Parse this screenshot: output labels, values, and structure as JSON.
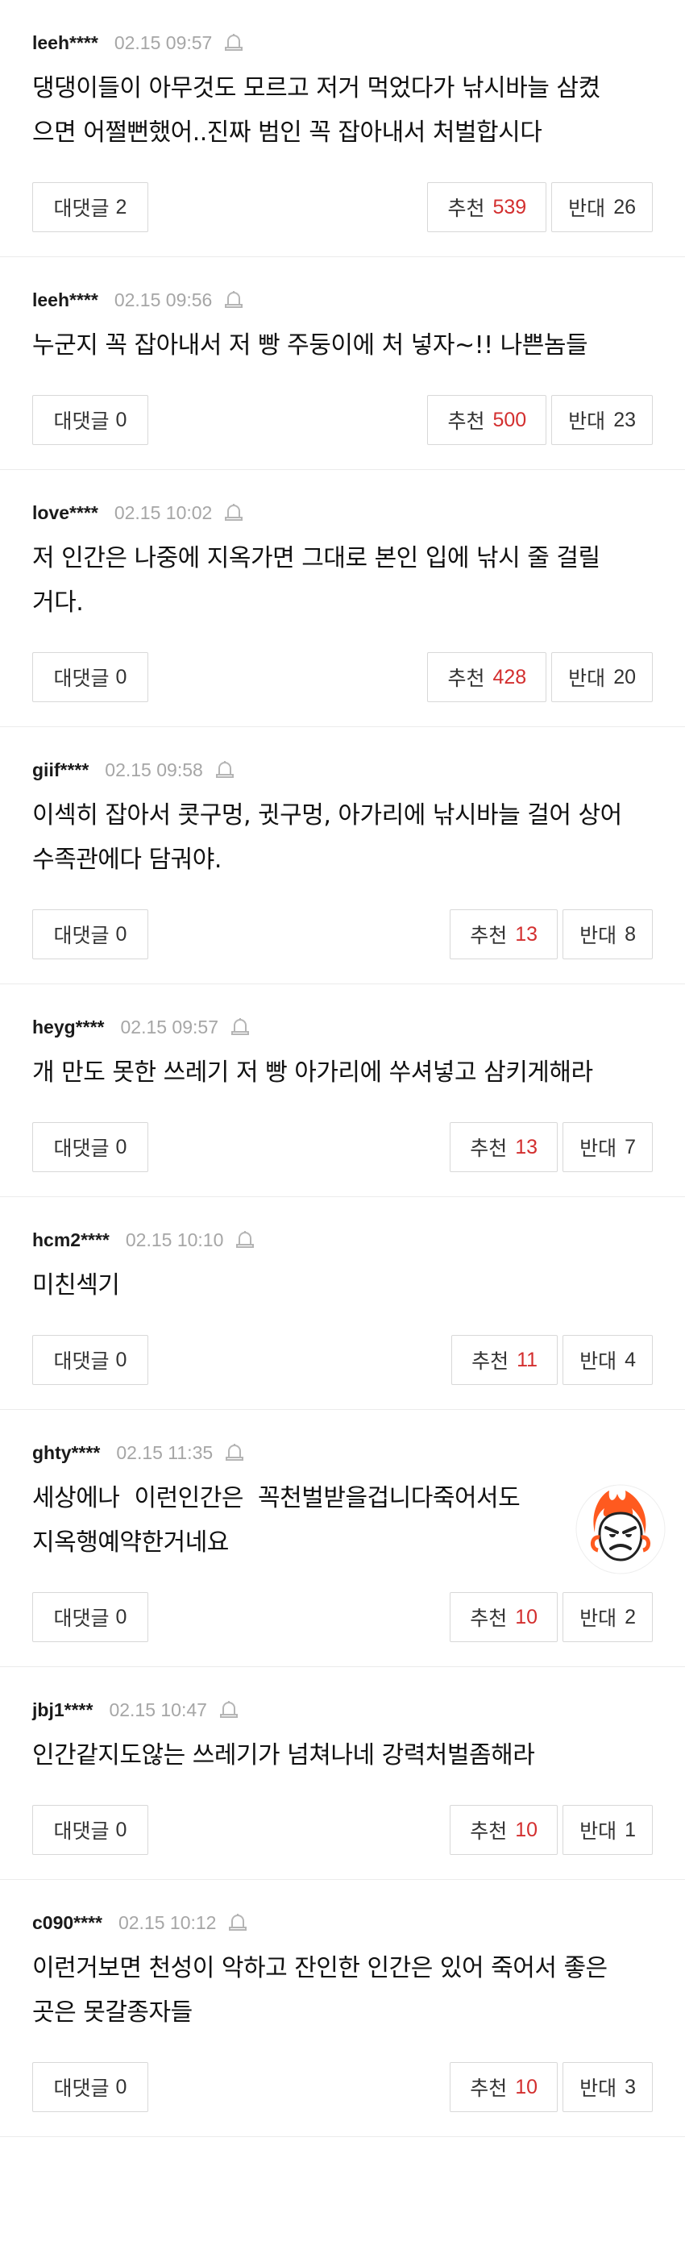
{
  "labels": {
    "reply": "대댓글",
    "recommend": "추천",
    "oppose": "반대"
  },
  "comments": [
    {
      "user": "leeh****",
      "date": "02.15 09:57",
      "lines": [
        "댕댕이들이 아무것도 모르고 저거 먹었다가 낚시바늘 삼켰",
        "으면 어쩔뻔했어..진짜 범인 꼭 잡아내서 처벌합시다"
      ],
      "replies": "2",
      "recommend": "539",
      "oppose": "26"
    },
    {
      "user": "leeh****",
      "date": "02.15 09:56",
      "lines": [
        "누군지 꼭 잡아내서 저 빵 주둥이에 처 넣자~!! 나쁜놈들"
      ],
      "replies": "0",
      "recommend": "500",
      "oppose": "23"
    },
    {
      "user": "love****",
      "date": "02.15 10:02",
      "lines": [
        "저 인간은 나중에 지옥가면 그대로 본인 입에 낚시 줄 걸릴",
        "거다."
      ],
      "replies": "0",
      "recommend": "428",
      "oppose": "20"
    },
    {
      "user": "giif****",
      "date": "02.15 09:58",
      "lines": [
        "이섹히 잡아서 콧구멍, 귓구멍, 아가리에 낚시바늘 걸어 상어",
        "수족관에다 담궈야."
      ],
      "replies": "0",
      "recommend": "13",
      "oppose": "8"
    },
    {
      "user": "heyg****",
      "date": "02.15 09:57",
      "lines": [
        "개 만도 못한 쓰레기 저 빵 아가리에 쑤셔넣고 삼키게해라"
      ],
      "replies": "0",
      "recommend": "13",
      "oppose": "7"
    },
    {
      "user": "hcm2****",
      "date": "02.15 10:10",
      "lines": [
        "미친섹기"
      ],
      "replies": "0",
      "recommend": "11",
      "oppose": "4"
    },
    {
      "user": "ghty****",
      "date": "02.15 11:35",
      "lines": [
        "세상에나  이런인간은  꼭천벌받을겁니다죽어서도",
        "지옥행예약한거네요"
      ],
      "replies": "0",
      "recommend": "10",
      "oppose": "2",
      "avatar": "angry-face-icon"
    },
    {
      "user": "jbj1****",
      "date": "02.15 10:47",
      "lines": [
        "인간같지도않는 쓰레기가 넘쳐나네 강력처벌좀해라"
      ],
      "replies": "0",
      "recommend": "10",
      "oppose": "1"
    },
    {
      "user": "c090****",
      "date": "02.15 10:12",
      "lines": [
        "이런거보면 천성이 악하고 잔인한 인간은 있어 죽어서 좋은",
        "곳은 못갈종자들"
      ],
      "replies": "0",
      "recommend": "10",
      "oppose": "3"
    }
  ],
  "colors": {
    "recommend": "#d32f2f",
    "border": "#d8d8d8",
    "date": "#a6a6a6"
  },
  "icons": {
    "report": "bell-icon"
  }
}
